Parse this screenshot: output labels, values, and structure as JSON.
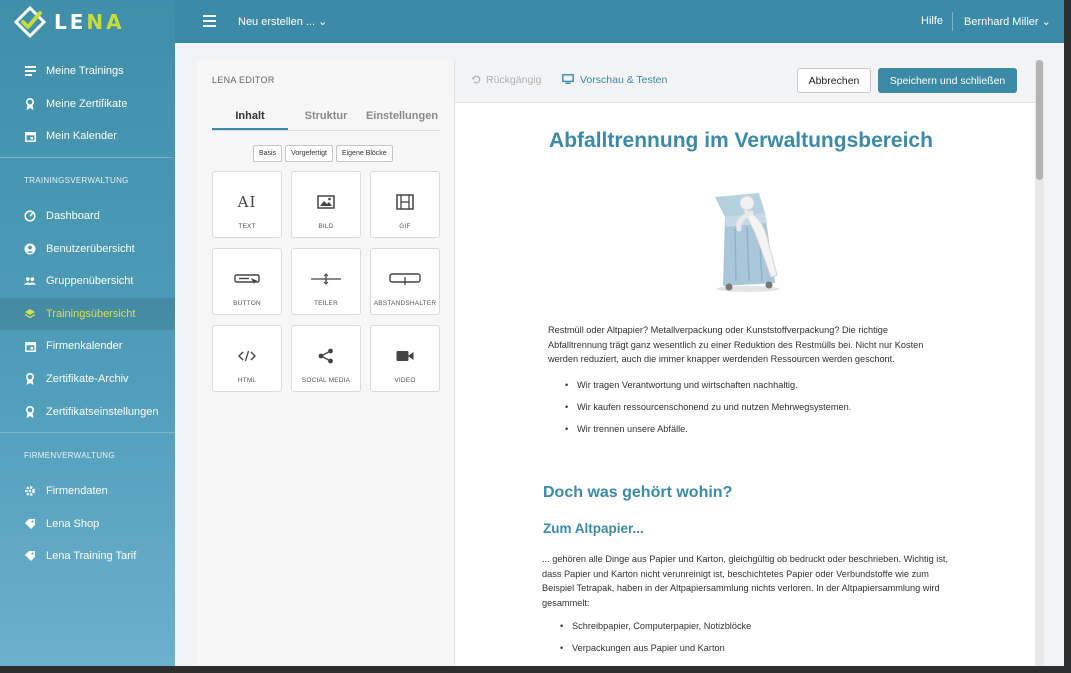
{
  "brand": {
    "logo_text_a": "LE",
    "logo_text_b": "NA"
  },
  "topbar": {
    "new_menu": "Neu erstellen ... ⌄",
    "help": "Hilfe",
    "user": "Bernhard Miller ⌄"
  },
  "sidebar": {
    "items_personal": [
      {
        "label": "Meine Trainings",
        "icon": "list-icon"
      },
      {
        "label": "Meine Zertifikate",
        "icon": "certificate-icon"
      },
      {
        "label": "Mein Kalender",
        "icon": "calendar-icon"
      }
    ],
    "section_training": "TRAININGSVERWALTUNG",
    "items_training": [
      {
        "label": "Dashboard",
        "icon": "dashboard-icon"
      },
      {
        "label": "Benutzerübersicht",
        "icon": "user-icon"
      },
      {
        "label": "Gruppenübersicht",
        "icon": "group-icon"
      },
      {
        "label": "Trainingsübersicht",
        "icon": "layers-icon",
        "active": true
      },
      {
        "label": "Firmenkalender",
        "icon": "calendar-icon"
      },
      {
        "label": "Zertifikate-Archiv",
        "icon": "certificate-icon"
      },
      {
        "label": "Zertifikatseinstellungen",
        "icon": "certificate-icon"
      }
    ],
    "section_company": "FIRMENVERWALTUNG",
    "items_company": [
      {
        "label": "Firmendaten",
        "icon": "gear-icon"
      },
      {
        "label": "Lena Shop",
        "icon": "tag-icon"
      },
      {
        "label": "Lena Training Tarif",
        "icon": "tag-icon"
      }
    ]
  },
  "editor": {
    "title": "LENA EDITOR",
    "tabs": [
      "Inhalt",
      "Struktur",
      "Einstellungen"
    ],
    "subtabs": [
      "Basis",
      "Vorgefertigt",
      "Eigene Blöcke"
    ],
    "blocks": [
      "TEXT",
      "BILD",
      "GIF",
      "BUTTON",
      "TEILER",
      "ABSTANDSHALTER",
      "HTML",
      "SOCIAL MEDIA",
      "VIDEO"
    ],
    "text_icon_glyph": "AI"
  },
  "toolbar": {
    "undo": "Rückgängig",
    "preview": "Vorschau & Testen",
    "cancel": "Abbrechen",
    "save": "Speichern und schließen"
  },
  "document": {
    "title": "Abfalltrennung im Verwaltungsbereich",
    "intro": "Restmüll oder Altpapier? Metallverpackung oder Kunststoffverpackung? Die richtige Abfalltrennung trägt ganz wesentlich zu einer Reduktion des Restmülls bei. Nicht nur Kosten werden reduziert, auch die immer knapper werdenden Ressourcen werden geschont.",
    "bullets1": [
      "Wir tragen Verantwortung und wirtschaften nachhaltig.",
      "Wir kaufen ressourcenschonend zu und nutzen Mehrwegsystemen.",
      "Wir trennen unsere Abfälle."
    ],
    "heading2": "Doch was gehört wohin?",
    "heading3": "Zum Altpapier...",
    "para2": "... gehören alle Dinge aus Papier und Karton, gleichgültig ob bedruckt oder beschrieben. Wichtig ist, dass Papier und Karton nicht verunreinigt ist, beschichtetes Papier oder Verbundstoffe wie zum Beispiel Tetrapak, haben in der Altpapiersammlung nichts verloren. In der Altpapiersammlung wird gesammelt:",
    "bullets2": [
      "Schreibpapier, Computerpapier, Notizblöcke",
      "Verpackungen aus Papier und Karton"
    ]
  },
  "colors": {
    "accent": "#3b8ba8",
    "active_nav": "#d2e24a",
    "logo_green": "#c9db37"
  }
}
